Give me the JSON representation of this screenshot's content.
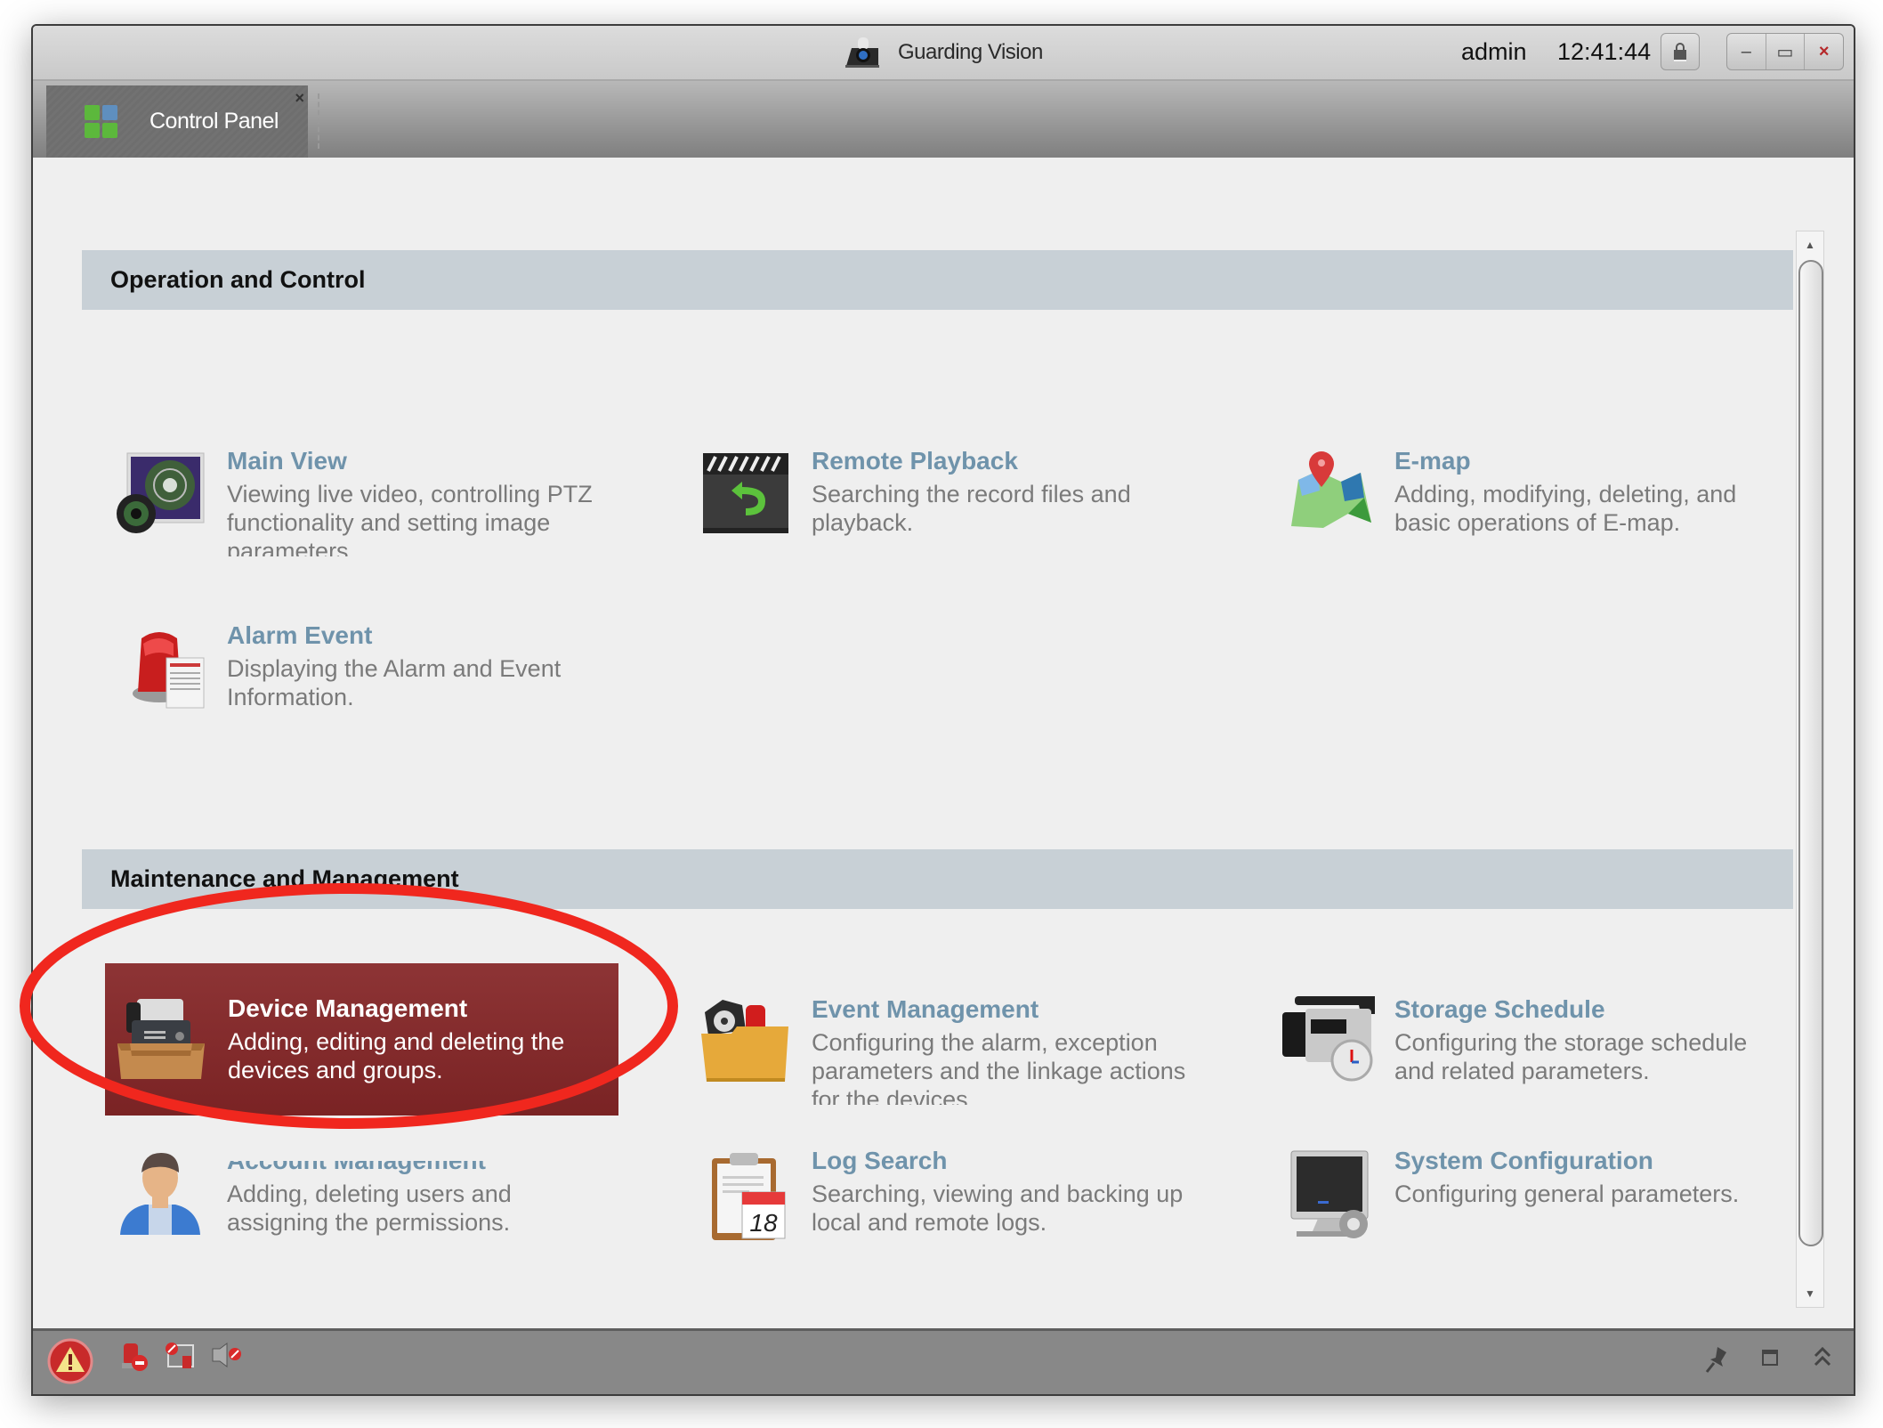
{
  "titlebar": {
    "app_title": "Guarding Vision",
    "user": "admin",
    "time": "12:41:44",
    "buttons": {
      "minimize": "–",
      "maximize": "▭",
      "close": "×"
    }
  },
  "tabs": [
    {
      "label": "Control Panel",
      "close": "×",
      "active": true
    }
  ],
  "sections": [
    {
      "title": "Operation and Control",
      "items": [
        {
          "title": "Main View",
          "description": "Viewing live video, controlling PTZ functionality and setting image parameters.",
          "icon": "main-view-icon"
        },
        {
          "title": "Remote Playback",
          "description": "Searching the record files and playback.",
          "icon": "playback-clapper-icon"
        },
        {
          "title": "E-map",
          "description": "Adding, modifying, deleting, and basic operations of E-map.",
          "icon": "map-pin-icon"
        },
        {
          "title": "Alarm Event",
          "description": "Displaying the Alarm and Event Information.",
          "icon": "alarm-siren-icon"
        }
      ]
    },
    {
      "title": "Maintenance and Management",
      "items": [
        {
          "title": "Device Management",
          "description": "Adding, editing and deleting the devices and groups.",
          "icon": "device-drawer-icon",
          "highlighted": true
        },
        {
          "title": "Event Management",
          "description": "Configuring the alarm, exception parameters and the linkage actions for the devices.",
          "icon": "event-folder-icon"
        },
        {
          "title": "Storage Schedule",
          "description": "Configuring the storage schedule and related parameters.",
          "icon": "camcorder-clock-icon"
        },
        {
          "title": "Account Management",
          "description": "Adding, deleting users and assigning the permissions.",
          "icon": "user-account-icon"
        },
        {
          "title": "Log Search",
          "description": "Searching, viewing and backing up local and remote logs.",
          "icon": "clipboard-calendar-icon",
          "calendar_day": "18"
        },
        {
          "title": "System Configuration",
          "description": "Configuring general parameters.",
          "icon": "monitor-gear-icon"
        }
      ]
    }
  ],
  "statusbar": {
    "left_icons": [
      "alarm-warning-icon",
      "alarm-disabled-icon",
      "event-disabled-icon",
      "audio-disabled-icon"
    ],
    "right_icons": [
      "pin-icon",
      "window-icon",
      "expand-up-icon"
    ]
  },
  "colors": {
    "highlight": "#8a2f30",
    "link_title": "#6f93ab",
    "section_header_bg": "#c8d0d6",
    "annotation": "#f0271e"
  }
}
